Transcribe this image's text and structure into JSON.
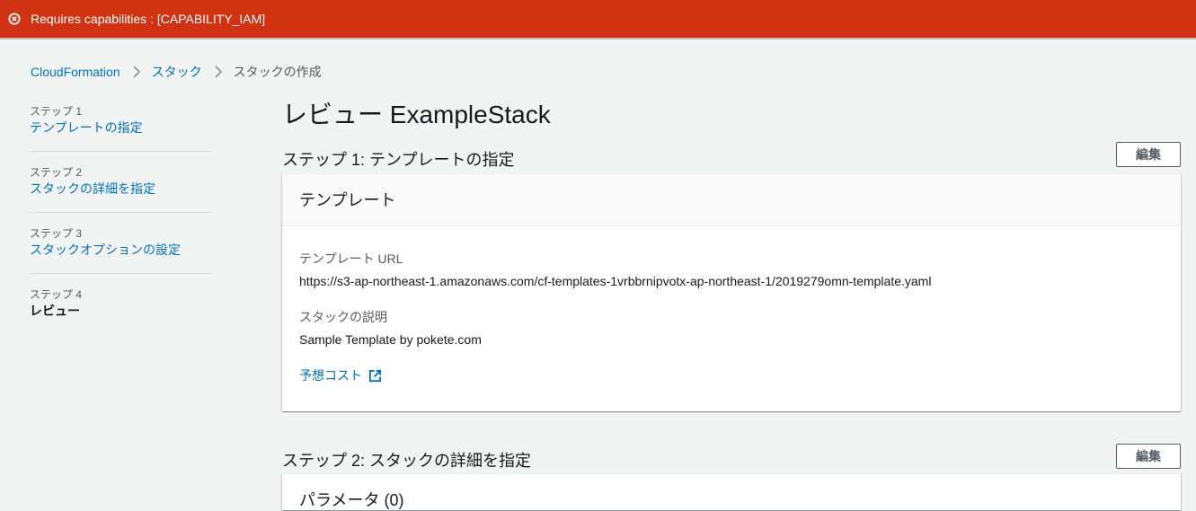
{
  "banner": {
    "message": "Requires capabilities : [CAPABILITY_IAM]",
    "color": "#d13212"
  },
  "breadcrumb": {
    "items": [
      "CloudFormation",
      "スタック"
    ],
    "current": "スタックの作成"
  },
  "steps": [
    {
      "num": "ステップ 1",
      "label": "テンプレートの指定"
    },
    {
      "num": "ステップ 2",
      "label": "スタックの詳細を指定"
    },
    {
      "num": "ステップ 3",
      "label": "スタックオプションの設定"
    },
    {
      "num": "ステップ 4",
      "label": "レビュー"
    }
  ],
  "page_title": "レビュー ExampleStack",
  "section1": {
    "heading": "ステップ 1: テンプレートの指定",
    "edit_label": "編集",
    "panel_title": "テンプレート",
    "template_url_label": "テンプレート URL",
    "template_url_value": "https://s3-ap-northeast-1.amazonaws.com/cf-templates-1vrbbrnipvotx-ap-northeast-1/2019279omn-template.yaml",
    "description_label": "スタックの説明",
    "description_value": "Sample Template by pokete.com",
    "cost_link": "予想コスト"
  },
  "section2": {
    "heading": "ステップ 2: スタックの詳細を指定",
    "edit_label": "編集",
    "panel_title": "パラメータ (0)"
  },
  "icons": {
    "banner": "error-circle-icon",
    "breadcrumb_sep": "chevron-right-icon",
    "external": "external-link-icon"
  }
}
